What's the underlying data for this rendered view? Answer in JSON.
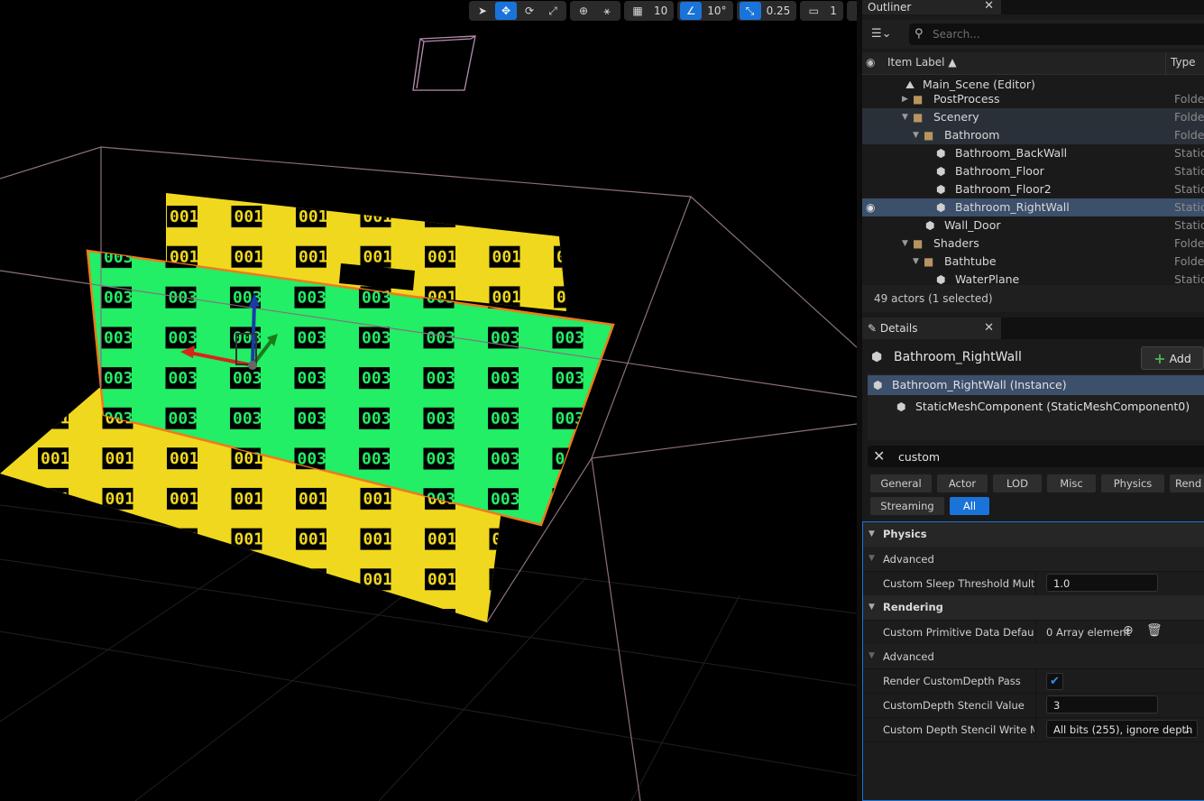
{
  "toolbar": {
    "grid_value": "10",
    "angle_value": "10°",
    "scale_value": "0.25",
    "camera_value": "1"
  },
  "viewport": {
    "tile_labels": [
      "001",
      "003"
    ],
    "colors": {
      "yellow_plane": "#f0d81e",
      "green_plane": "#22ee66",
      "edge": "#f07a1a",
      "wire": "#8a6f80"
    }
  },
  "outliner": {
    "tab_label": "Outliner",
    "search_placeholder": "Search...",
    "col_label": "Item Label ▲",
    "col_type": "Type",
    "rows": [
      {
        "label": "Main_Scene (Editor)",
        "type": ""
      },
      {
        "label": "PostProcess",
        "type": "Folder"
      },
      {
        "label": "Scenery",
        "type": "Folder"
      },
      {
        "label": "Bathroom",
        "type": "Folder"
      },
      {
        "label": "Bathroom_BackWall",
        "type": "Static"
      },
      {
        "label": "Bathroom_Floor",
        "type": "Static"
      },
      {
        "label": "Bathroom_Floor2",
        "type": "Static"
      },
      {
        "label": "Bathroom_RightWall",
        "type": "Static"
      },
      {
        "label": "Wall_Door",
        "type": "Static"
      },
      {
        "label": "Shaders",
        "type": "Folder"
      },
      {
        "label": "Bathtube",
        "type": "Folder"
      },
      {
        "label": "WaterPlane",
        "type": "Static"
      }
    ],
    "status": "49 actors (1 selected)"
  },
  "details": {
    "tab_label": "Details",
    "actor_name": "Bathroom_RightWall",
    "add_label": "Add",
    "components": [
      "Bathroom_RightWall (Instance)",
      "StaticMeshComponent (StaticMeshComponent0)"
    ],
    "search_value": "custom",
    "categories_row1": [
      "General",
      "Actor",
      "LOD",
      "Misc",
      "Physics",
      "Rend"
    ],
    "categories_row2": [
      "Streaming",
      "All"
    ],
    "sections": {
      "physics": "Physics",
      "physics_adv": "Advanced",
      "rendering": "Rendering",
      "rendering_adv": "Advanced"
    },
    "props": {
      "sleep_label": "Custom Sleep Threshold Multip...",
      "sleep_value": "1.0",
      "prim_label": "Custom Primitive Data Defaults",
      "prim_value": "0 Array element",
      "depth_pass_label": "Render CustomDepth Pass",
      "depth_pass_check": "✔",
      "stencil_label": "CustomDepth Stencil Value",
      "stencil_value": "3",
      "write_mask_label": "Custom Depth Stencil Write Ma...",
      "write_mask_value": "All bits (255), ignore depth"
    }
  }
}
